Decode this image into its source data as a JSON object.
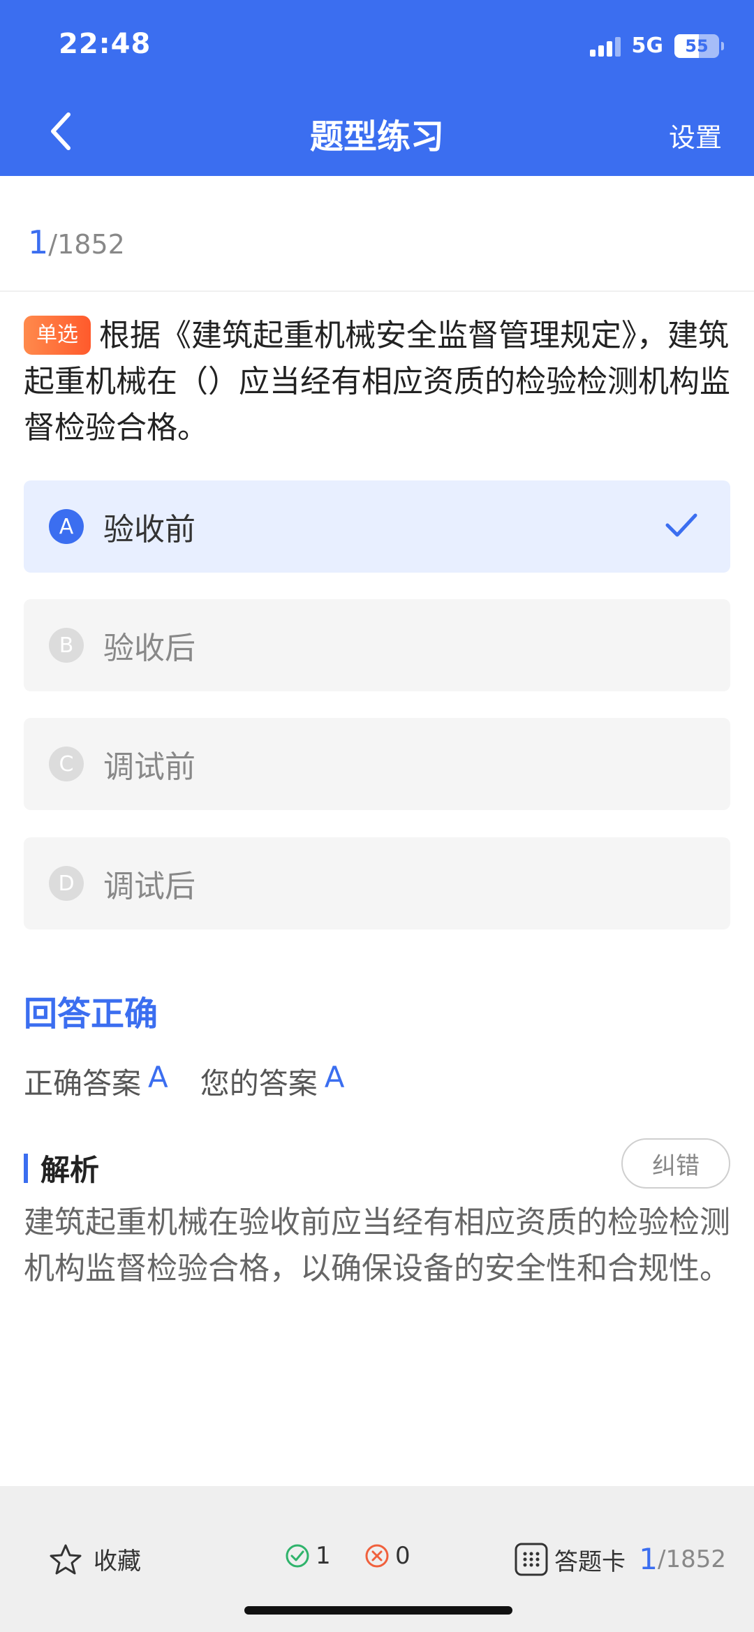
{
  "status": {
    "time": "22:48",
    "network": "5G",
    "battery": "55"
  },
  "header": {
    "title": "题型练习",
    "settings_label": "设置"
  },
  "progress": {
    "current": "1",
    "total": "/1852"
  },
  "question": {
    "type_badge": "单选",
    "text": "根据《建筑起重机械安全监督管理规定》，建筑起重机械在（）应当经有相应资质的检验检测机构监督检验合格。"
  },
  "options": [
    {
      "letter": "A",
      "text": "验收前",
      "selected": true
    },
    {
      "letter": "B",
      "text": "验收后",
      "selected": false
    },
    {
      "letter": "C",
      "text": "调试前",
      "selected": false
    },
    {
      "letter": "D",
      "text": "调试后",
      "selected": false
    }
  ],
  "result": {
    "status": "回答正确",
    "correct_label": "正确答案",
    "correct_value": "A",
    "yours_label": "您的答案",
    "yours_value": "A"
  },
  "analysis": {
    "title": "解析",
    "report_label": "纠错",
    "text": "建筑起重机械在验收前应当经有相应资质的检验检测机构监督检验合格，以确保设备的安全性和合规性。"
  },
  "bottom_bar": {
    "favorite_label": "收藏",
    "right_count": "1",
    "wrong_count": "0",
    "card_label": "答题卡",
    "current": "1",
    "total": "/1852"
  },
  "colors": {
    "accent": "#3b6ef0",
    "badge": "#ff6a3c",
    "right": "#2fb36b",
    "wrong": "#f0603c"
  }
}
